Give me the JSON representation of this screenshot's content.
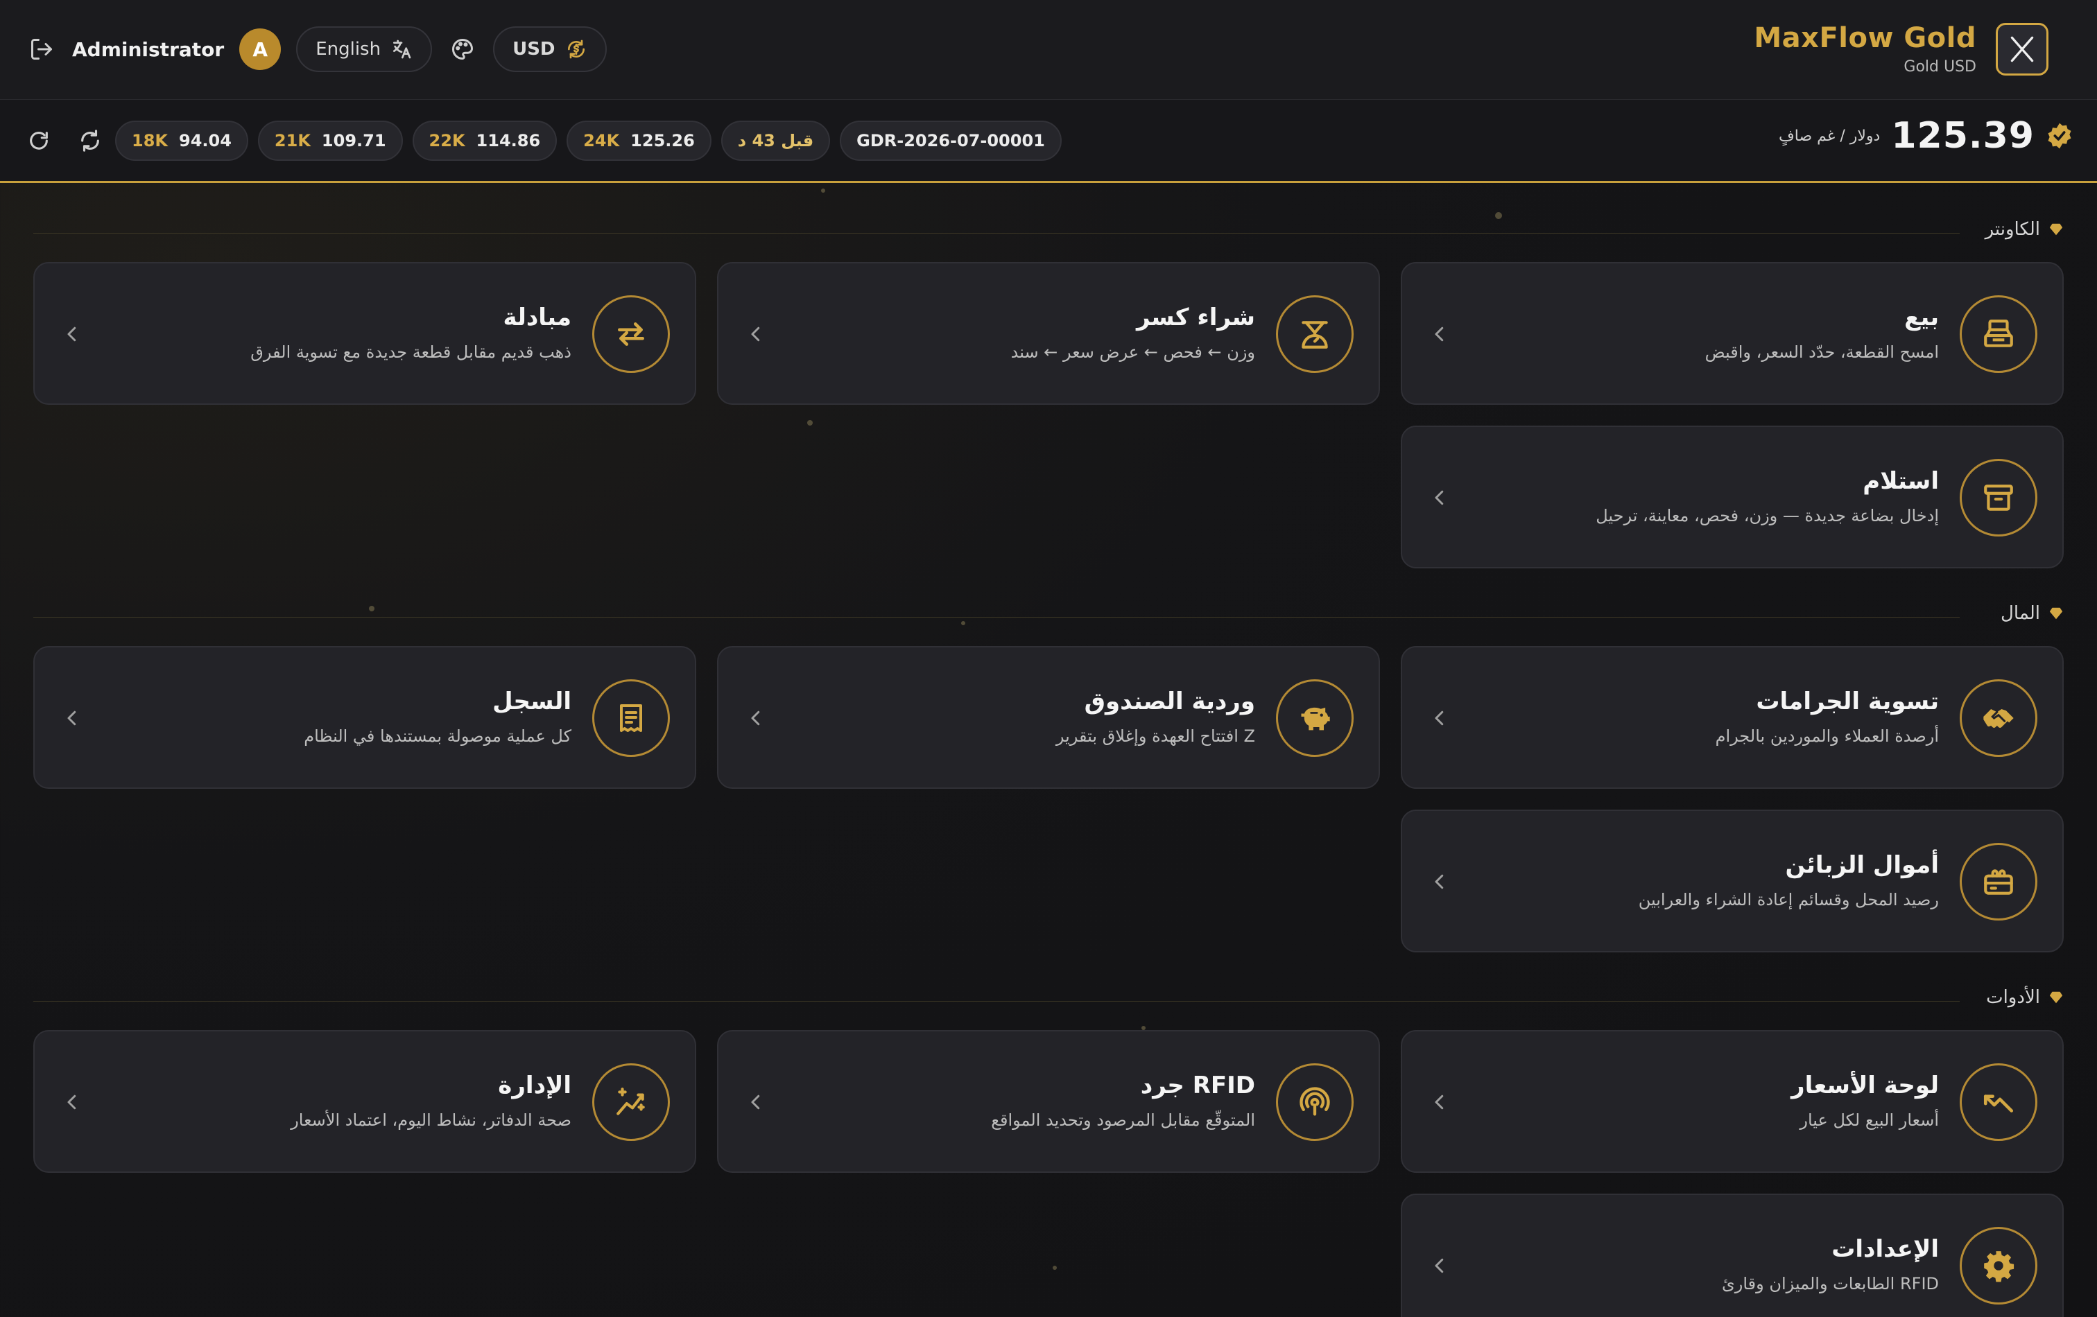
{
  "header": {
    "brand_title": "MaxFlow Gold",
    "brand_subtitle": "Gold USD",
    "user_name": "Administrator",
    "user_initial": "A",
    "language_label": "English",
    "currency_label": "USD"
  },
  "price_bar": {
    "chips": [
      {
        "karat": "18K",
        "price": "94.04"
      },
      {
        "karat": "21K",
        "price": "109.71"
      },
      {
        "karat": "22K",
        "price": "114.86"
      },
      {
        "karat": "24K",
        "price": "125.26"
      }
    ],
    "updated_ago": "قبل 43 د",
    "rate_id": "GDR-2026-07-00001",
    "main_price": "125.39",
    "main_unit": "دولار / غم صافٍ"
  },
  "sections": {
    "counter": {
      "title": "الكاونتر",
      "sell": {
        "title": "بيع",
        "subtitle": "امسح القطعة، حدّد السعر، واقبض"
      },
      "buy_scrap": {
        "title": "شراء كسر",
        "subtitle": "وزن ← فحص ← عرض سعر ← سند"
      },
      "exchange": {
        "title": "مبادلة",
        "subtitle": "ذهب قديم مقابل قطعة جديدة مع تسوية الفرق"
      },
      "receive": {
        "title": "استلام",
        "subtitle": "إدخال بضاعة جديدة — وزن، فحص، معاينة، ترحيل"
      }
    },
    "money": {
      "title": "المال",
      "grams_settlement": {
        "title": "تسوية الجرامات",
        "subtitle": "أرصدة العملاء والموردين بالجرام"
      },
      "cash_shift": {
        "title": "وردية الصندوق",
        "subtitle": "افتتاح العهدة وإغلاق بتقرير Z"
      },
      "ledger": {
        "title": "السجل",
        "subtitle": "كل عملية موصولة بمستندها في النظام"
      },
      "customer_funds": {
        "title": "أموال الزبائن",
        "subtitle": "رصيد المحل وقسائم إعادة الشراء والعرابين"
      }
    },
    "tools": {
      "title": "الأدوات",
      "price_board": {
        "title": "لوحة الأسعار",
        "subtitle": "أسعار البيع لكل عيار"
      },
      "rfid_count": {
        "title": "جرد RFID",
        "subtitle": "المتوقّع مقابل المرصود وتحديد المواقع"
      },
      "management": {
        "title": "الإدارة",
        "subtitle": "صحة الدفاتر، نشاط اليوم، اعتماد الأسعار"
      },
      "settings": {
        "title": "الإعدادات",
        "subtitle": "الطابعات والميزان وقارئ RFID"
      }
    }
  },
  "colors": {
    "accent": "#d4a843",
    "background": "#141416",
    "card": "#232328"
  }
}
